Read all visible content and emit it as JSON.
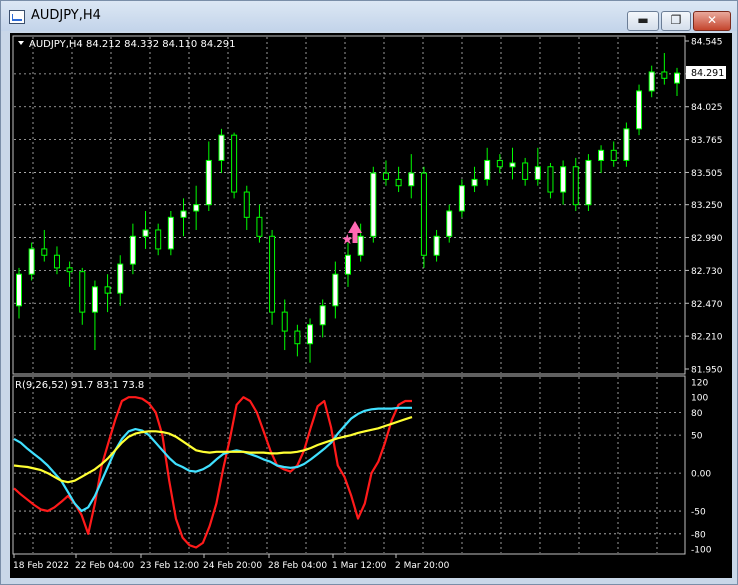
{
  "window": {
    "title": "AUDJPY,H4",
    "minimize_label": "▬",
    "restore_label": "❐",
    "close_label": "✕"
  },
  "chart_data": [
    {
      "type": "candlestick",
      "header": "AUDJPY,H4  84.212 84.332 84.110 84.291",
      "price_tag": "84.291",
      "ylim": [
        81.95,
        84.545
      ],
      "y_ticks": [
        "84.545",
        "84.285",
        "84.025",
        "83.765",
        "83.505",
        "83.250",
        "82.990",
        "82.730",
        "82.470",
        "82.210",
        "81.950"
      ],
      "x_ticks": [
        "18 Feb 2022",
        "22 Feb 04:00",
        "23 Feb 12:00",
        "24 Feb 20:00",
        "28 Feb 04:00",
        "1 Mar 12:00",
        "2 Mar 20:00"
      ],
      "grid": true,
      "bull_color": "#ffffff",
      "bear_color": "#000000",
      "wick_color": "#00ff00",
      "marker_colors": {
        "arrow": "#ff69b4",
        "star": "#ff69b4"
      },
      "candles": [
        [
          82.45,
          82.75,
          82.35,
          82.7
        ],
        [
          82.7,
          82.95,
          82.65,
          82.9
        ],
        [
          82.9,
          83.05,
          82.8,
          82.85
        ],
        [
          82.85,
          82.92,
          82.7,
          82.75
        ],
        [
          82.75,
          82.8,
          82.6,
          82.72
        ],
        [
          82.72,
          82.75,
          82.3,
          82.4
        ],
        [
          82.4,
          82.65,
          82.1,
          82.6
        ],
        [
          82.6,
          82.7,
          82.4,
          82.55
        ],
        [
          82.55,
          82.85,
          82.45,
          82.78
        ],
        [
          82.78,
          83.1,
          82.7,
          83.0
        ],
        [
          83.0,
          83.2,
          82.9,
          83.05
        ],
        [
          83.05,
          83.1,
          82.85,
          82.9
        ],
        [
          82.9,
          83.2,
          82.85,
          83.15
        ],
        [
          83.15,
          83.3,
          83.0,
          83.2
        ],
        [
          83.2,
          83.4,
          83.05,
          83.25
        ],
        [
          83.25,
          83.75,
          83.2,
          83.6
        ],
        [
          83.6,
          83.85,
          83.5,
          83.8
        ],
        [
          83.8,
          83.82,
          83.3,
          83.35
        ],
        [
          83.35,
          83.4,
          83.05,
          83.15
        ],
        [
          83.15,
          83.25,
          82.95,
          83.0
        ],
        [
          83.0,
          83.05,
          82.3,
          82.4
        ],
        [
          82.4,
          82.5,
          82.1,
          82.25
        ],
        [
          82.25,
          82.3,
          82.05,
          82.15
        ],
        [
          82.15,
          82.35,
          82.0,
          82.3
        ],
        [
          82.3,
          82.5,
          82.2,
          82.45
        ],
        [
          82.45,
          82.8,
          82.35,
          82.7
        ],
        [
          82.7,
          82.95,
          82.6,
          82.85
        ],
        [
          82.85,
          83.1,
          82.8,
          83.0
        ],
        [
          83.0,
          83.55,
          82.95,
          83.5
        ],
        [
          83.5,
          83.6,
          83.4,
          83.45
        ],
        [
          83.45,
          83.55,
          83.35,
          83.4
        ],
        [
          83.4,
          83.65,
          83.3,
          83.5
        ],
        [
          83.5,
          83.55,
          82.75,
          82.85
        ],
        [
          82.85,
          83.05,
          82.8,
          83.0
        ],
        [
          83.0,
          83.25,
          82.95,
          83.2
        ],
        [
          83.2,
          83.45,
          83.15,
          83.4
        ],
        [
          83.4,
          83.55,
          83.35,
          83.45
        ],
        [
          83.45,
          83.7,
          83.4,
          83.6
        ],
        [
          83.6,
          83.65,
          83.5,
          83.55
        ],
        [
          83.55,
          83.7,
          83.45,
          83.58
        ],
        [
          83.58,
          83.62,
          83.4,
          83.45
        ],
        [
          83.45,
          83.7,
          83.4,
          83.55
        ],
        [
          83.55,
          83.58,
          83.3,
          83.35
        ],
        [
          83.35,
          83.6,
          83.25,
          83.55
        ],
        [
          83.55,
          83.62,
          83.2,
          83.25
        ],
        [
          83.25,
          83.65,
          83.2,
          83.6
        ],
        [
          83.6,
          83.72,
          83.5,
          83.68
        ],
        [
          83.68,
          83.75,
          83.55,
          83.6
        ],
        [
          83.6,
          83.9,
          83.55,
          83.85
        ],
        [
          83.85,
          84.2,
          83.8,
          84.15
        ],
        [
          84.15,
          84.35,
          84.1,
          84.3
        ],
        [
          84.3,
          84.45,
          84.2,
          84.25
        ],
        [
          84.212,
          84.332,
          84.11,
          84.291
        ]
      ]
    },
    {
      "type": "line",
      "header": "R(9,26,52) 91.7 83.1 73.8",
      "ylim": [
        -100,
        120
      ],
      "y_ticks": [
        "120",
        "100",
        "80",
        "50",
        "0.00",
        "-50",
        "-80",
        "-100"
      ],
      "grid": true,
      "series": [
        {
          "color": "#ff1a1a",
          "values": [
            -20,
            -28,
            -35,
            -42,
            -48,
            -50,
            -45,
            -38,
            -30,
            -40,
            -55,
            -80,
            -40,
            10,
            40,
            70,
            95,
            100,
            100,
            98,
            92,
            80,
            50,
            -10,
            -60,
            -85,
            -95,
            -98,
            -92,
            -70,
            -40,
            5,
            45,
            90,
            100,
            95,
            80,
            55,
            30,
            10,
            5,
            2,
            10,
            30,
            60,
            88,
            95,
            60,
            10,
            -5,
            -30,
            -60,
            -40,
            0,
            15,
            40,
            70,
            90,
            95,
            95
          ]
        },
        {
          "color": "#40e0ff",
          "values": [
            45,
            40,
            32,
            25,
            18,
            10,
            0,
            -10,
            -25,
            -40,
            -50,
            -45,
            -30,
            -10,
            10,
            30,
            45,
            55,
            58,
            56,
            50,
            40,
            30,
            20,
            12,
            8,
            3,
            2,
            5,
            10,
            18,
            25,
            28,
            30,
            28,
            25,
            22,
            18,
            15,
            10,
            8,
            7,
            8,
            12,
            18,
            25,
            32,
            40,
            52,
            62,
            72,
            78,
            82,
            84,
            85,
            85,
            85,
            86,
            86,
            86
          ]
        },
        {
          "color": "#ffff33",
          "values": [
            10,
            9,
            8,
            6,
            4,
            0,
            -5,
            -10,
            -12,
            -10,
            -5,
            0,
            5,
            12,
            20,
            30,
            40,
            48,
            52,
            54,
            55,
            55,
            54,
            52,
            48,
            42,
            36,
            30,
            28,
            27,
            28,
            28,
            28,
            28,
            28,
            27,
            27,
            27,
            26,
            26,
            27,
            27,
            28,
            30,
            33,
            37,
            40,
            43,
            46,
            48,
            50,
            53,
            55,
            57,
            59,
            62,
            65,
            68,
            71,
            73.8
          ]
        }
      ]
    }
  ]
}
